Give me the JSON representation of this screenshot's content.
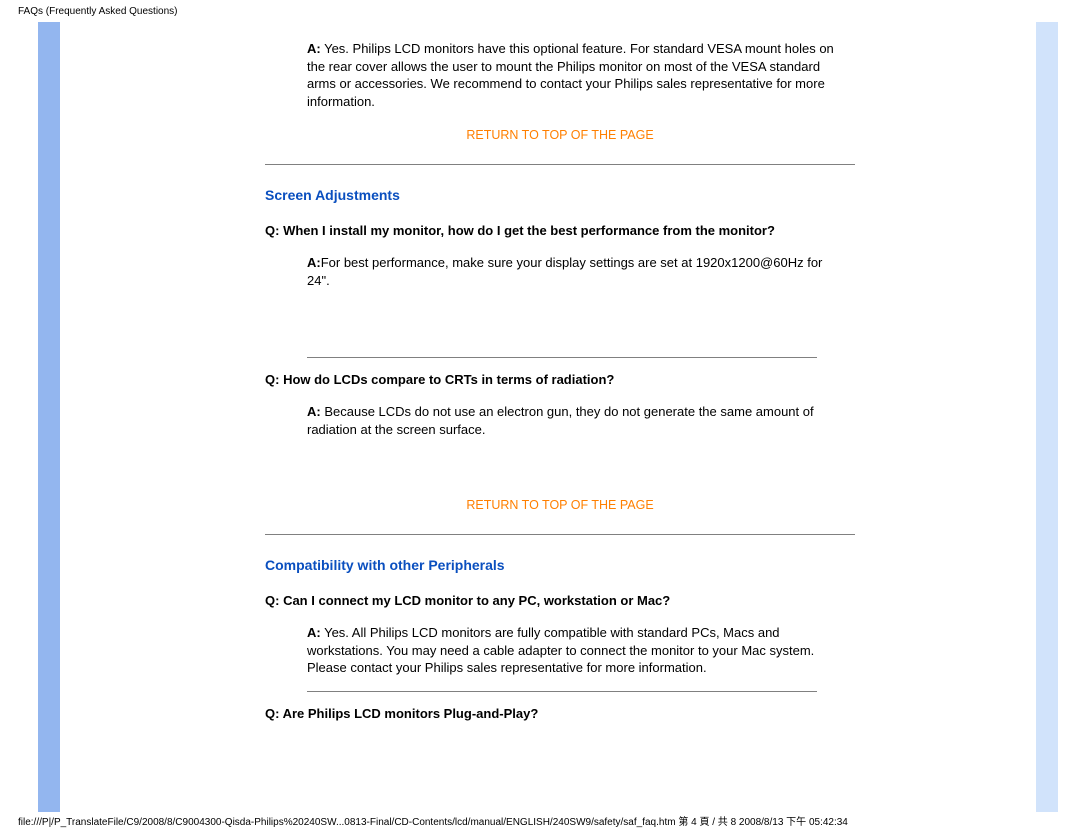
{
  "header": {
    "title": "FAQs (Frequently Asked Questions)"
  },
  "intro_answer": {
    "label": "A:",
    "text": " Yes. Philips LCD monitors have this optional feature. For standard VESA mount holes on the rear cover allows the user to mount the Philips monitor on most of the VESA standard arms or accessories. We recommend to contact your Philips sales representative for more information."
  },
  "return_label": "RETURN TO TOP OF THE PAGE",
  "section1": {
    "title": "Screen Adjustments",
    "q1": {
      "label": "Q:",
      "text": " When I install my monitor, how do I get the best performance from the monitor?"
    },
    "a1": {
      "label": "A:",
      "text": "For best performance, make sure your display settings are set at 1920x1200@60Hz for 24\"."
    },
    "q2": {
      "label": "Q:",
      "text": " How do LCDs compare to CRTs in terms of radiation?"
    },
    "a2": {
      "label": "A:",
      "text": " Because LCDs do not use an electron gun, they do not generate the same amount of radiation at the screen surface."
    }
  },
  "section2": {
    "title": "Compatibility with other Peripherals",
    "q1": {
      "label": "Q:",
      "text": " Can I connect my LCD monitor to any PC, workstation or Mac?"
    },
    "a1": {
      "label": "A:",
      "text": " Yes. All Philips LCD monitors are fully compatible with standard PCs, Macs and workstations. You may need a cable adapter to connect the monitor to your Mac system. Please contact your Philips sales representative for more information."
    },
    "q2": {
      "label": "Q:",
      "text": " Are Philips LCD monitors Plug-and-Play?"
    }
  },
  "footer": {
    "text": "file:///P|/P_TranslateFile/C9/2008/8/C9004300-Qisda-Philips%20240SW...0813-Final/CD-Contents/lcd/manual/ENGLISH/240SW9/safety/saf_faq.htm 第 4 頁 / 共 8 2008/8/13 下午 05:42:34"
  }
}
